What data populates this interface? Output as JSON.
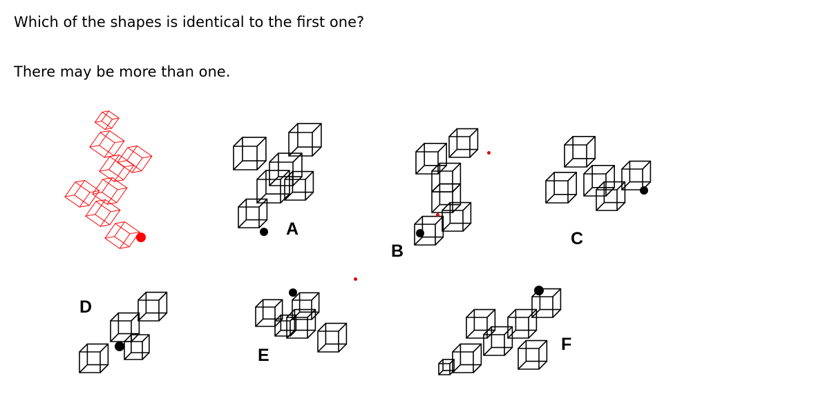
{
  "question": {
    "line1": "Which of the shapes is identical to the first one?",
    "line2": "There may be more than one."
  },
  "options": {
    "A": "A",
    "B": "B",
    "C": "C",
    "D": "D",
    "E": "E",
    "F": "F"
  },
  "colors": {
    "reference_shape": "#ff0000",
    "option_shapes": "#000000",
    "text": "#000000"
  }
}
